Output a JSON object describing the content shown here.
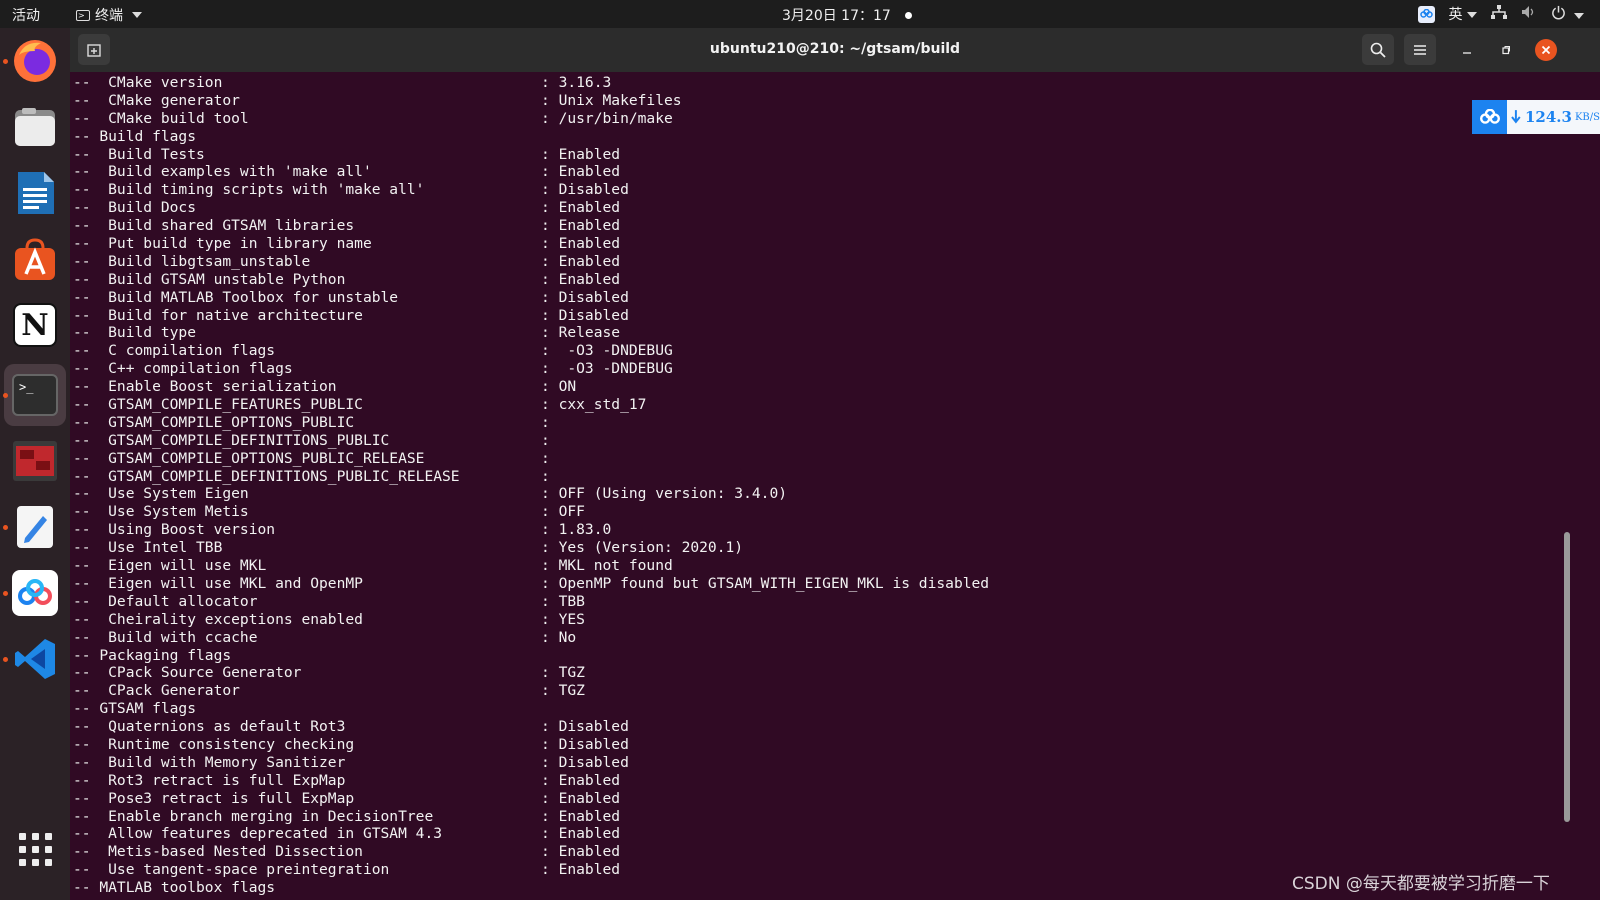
{
  "topbar": {
    "activities": "活动",
    "app_menu": "终端",
    "datetime": "3月20日 17：17",
    "input_method": "英"
  },
  "dock": {
    "items": [
      {
        "name": "firefox"
      },
      {
        "name": "files"
      },
      {
        "name": "libreoffice-writer"
      },
      {
        "name": "ubuntu-software"
      },
      {
        "name": "notion"
      },
      {
        "name": "terminal"
      },
      {
        "name": "remote-desktop"
      },
      {
        "name": "text-editor"
      },
      {
        "name": "baidu-netdisk"
      },
      {
        "name": "vscode"
      }
    ],
    "notion_letter": "N",
    "terminal_prompt": ">_"
  },
  "window": {
    "title": "ubuntu210@210: ~/gtsam/build"
  },
  "terminal": {
    "lines": [
      {
        "k": "--  CMake version",
        "v": ": 3.16.3"
      },
      {
        "k": "--  CMake generator",
        "v": ": Unix Makefiles"
      },
      {
        "k": "--  CMake build tool",
        "v": ": /usr/bin/make"
      },
      {
        "k": "-- Build flags",
        "v": ""
      },
      {
        "k": "--  Build Tests",
        "v": ": Enabled"
      },
      {
        "k": "--  Build examples with 'make all'",
        "v": ": Enabled"
      },
      {
        "k": "--  Build timing scripts with 'make all'",
        "v": ": Disabled"
      },
      {
        "k": "--  Build Docs",
        "v": ": Enabled"
      },
      {
        "k": "--  Build shared GTSAM libraries",
        "v": ": Enabled"
      },
      {
        "k": "--  Put build type in library name",
        "v": ": Enabled"
      },
      {
        "k": "--  Build libgtsam_unstable",
        "v": ": Enabled"
      },
      {
        "k": "--  Build GTSAM unstable Python",
        "v": ": Enabled"
      },
      {
        "k": "--  Build MATLAB Toolbox for unstable",
        "v": ": Disabled"
      },
      {
        "k": "--  Build for native architecture",
        "v": ": Disabled"
      },
      {
        "k": "--  Build type",
        "v": ": Release"
      },
      {
        "k": "--  C compilation flags",
        "v": ":  -O3 -DNDEBUG"
      },
      {
        "k": "--  C++ compilation flags",
        "v": ":  -O3 -DNDEBUG"
      },
      {
        "k": "--  Enable Boost serialization",
        "v": ": ON"
      },
      {
        "k": "--  GTSAM_COMPILE_FEATURES_PUBLIC",
        "v": ": cxx_std_17"
      },
      {
        "k": "--  GTSAM_COMPILE_OPTIONS_PUBLIC",
        "v": ":"
      },
      {
        "k": "--  GTSAM_COMPILE_DEFINITIONS_PUBLIC",
        "v": ":"
      },
      {
        "k": "--  GTSAM_COMPILE_OPTIONS_PUBLIC_RELEASE",
        "v": ":"
      },
      {
        "k": "--  GTSAM_COMPILE_DEFINITIONS_PUBLIC_RELEASE",
        "v": ":"
      },
      {
        "k": "--  Use System Eigen",
        "v": ": OFF (Using version: 3.4.0)"
      },
      {
        "k": "--  Use System Metis",
        "v": ": OFF"
      },
      {
        "k": "--  Using Boost version",
        "v": ": 1.83.0"
      },
      {
        "k": "--  Use Intel TBB",
        "v": ": Yes (Version: 2020.1)"
      },
      {
        "k": "--  Eigen will use MKL",
        "v": ": MKL not found"
      },
      {
        "k": "--  Eigen will use MKL and OpenMP",
        "v": ": OpenMP found but GTSAM_WITH_EIGEN_MKL is disabled"
      },
      {
        "k": "--  Default allocator",
        "v": ": TBB"
      },
      {
        "k": "--  Cheirality exceptions enabled",
        "v": ": YES"
      },
      {
        "k": "--  Build with ccache",
        "v": ": No"
      },
      {
        "k": "-- Packaging flags",
        "v": ""
      },
      {
        "k": "--  CPack Source Generator",
        "v": ": TGZ"
      },
      {
        "k": "--  CPack Generator",
        "v": ": TGZ"
      },
      {
        "k": "-- GTSAM flags",
        "v": ""
      },
      {
        "k": "--  Quaternions as default Rot3",
        "v": ": Disabled"
      },
      {
        "k": "--  Runtime consistency checking",
        "v": ": Disabled"
      },
      {
        "k": "--  Build with Memory Sanitizer",
        "v": ": Disabled"
      },
      {
        "k": "--  Rot3 retract is full ExpMap",
        "v": ": Enabled"
      },
      {
        "k": "--  Pose3 retract is full ExpMap",
        "v": ": Enabled"
      },
      {
        "k": "--  Enable branch merging in DecisionTree",
        "v": ": Enabled"
      },
      {
        "k": "--  Allow features deprecated in GTSAM 4.3",
        "v": ": Enabled"
      },
      {
        "k": "--  Metis-based Nested Dissection",
        "v": ": Enabled"
      },
      {
        "k": "--  Use tangent-space preintegration",
        "v": ": Enabled"
      },
      {
        "k": "-- MATLAB toolbox flags",
        "v": ""
      }
    ]
  },
  "speed_widget": {
    "value": "124.3",
    "unit": "KB/S"
  },
  "watermark": "CSDN @每天都要被学习折磨一下",
  "colors": {
    "terminal_bg": "#300a24",
    "accent": "#e95420",
    "baidu_blue": "#1c83f0"
  }
}
